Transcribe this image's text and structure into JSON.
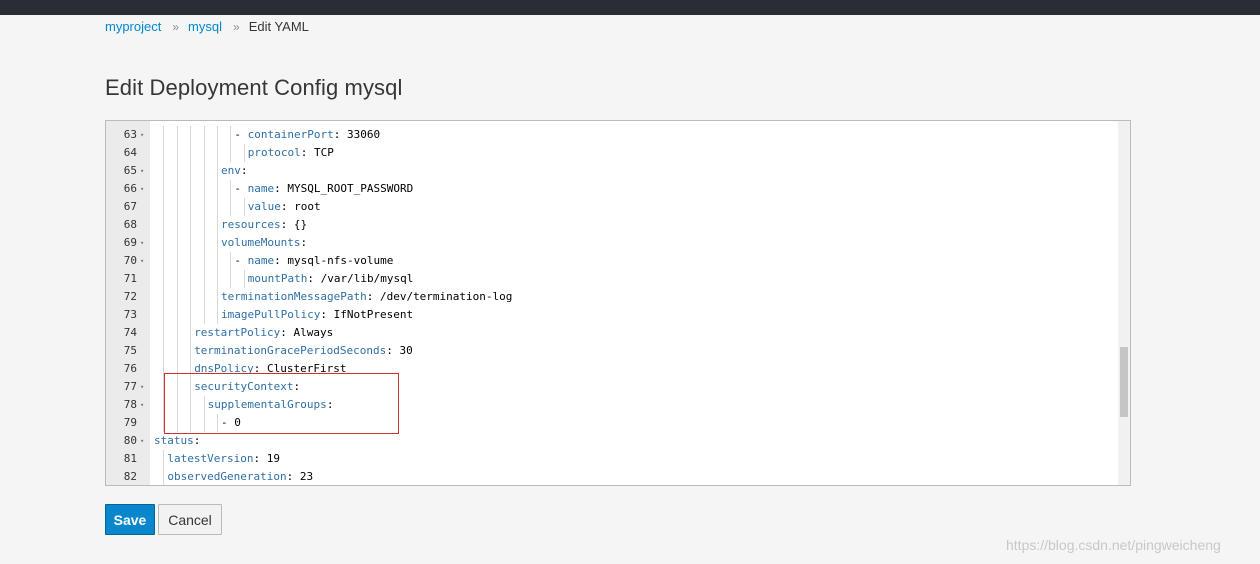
{
  "breadcrumb": {
    "items": [
      {
        "label": "myproject"
      },
      {
        "label": "mysql"
      }
    ],
    "separator": "»",
    "current": "Edit YAML"
  },
  "page_title": "Edit Deployment Config mysql",
  "editor": {
    "lines": [
      {
        "num": "63",
        "fold": true,
        "indent": 6,
        "dash": true,
        "key": "containerPort",
        "value": " 33060"
      },
      {
        "num": "64",
        "fold": false,
        "indent": 7,
        "dash": false,
        "key": "protocol",
        "value": " TCP"
      },
      {
        "num": "65",
        "fold": true,
        "indent": 5,
        "dash": false,
        "key": "env",
        "value": ""
      },
      {
        "num": "66",
        "fold": true,
        "indent": 6,
        "dash": true,
        "key": "name",
        "value": " MYSQL_ROOT_PASSWORD"
      },
      {
        "num": "67",
        "fold": false,
        "indent": 7,
        "dash": false,
        "key": "value",
        "value": " root"
      },
      {
        "num": "68",
        "fold": false,
        "indent": 5,
        "dash": false,
        "key": "resources",
        "value": " {}"
      },
      {
        "num": "69",
        "fold": true,
        "indent": 5,
        "dash": false,
        "key": "volumeMounts",
        "value": ""
      },
      {
        "num": "70",
        "fold": true,
        "indent": 6,
        "dash": true,
        "key": "name",
        "value": " mysql-nfs-volume"
      },
      {
        "num": "71",
        "fold": false,
        "indent": 7,
        "dash": false,
        "key": "mountPath",
        "value": " /var/lib/mysql"
      },
      {
        "num": "72",
        "fold": false,
        "indent": 5,
        "dash": false,
        "key": "terminationMessagePath",
        "value": " /dev/termination-log"
      },
      {
        "num": "73",
        "fold": false,
        "indent": 5,
        "dash": false,
        "key": "imagePullPolicy",
        "value": " IfNotPresent"
      },
      {
        "num": "74",
        "fold": false,
        "indent": 3,
        "dash": false,
        "key": "restartPolicy",
        "value": " Always"
      },
      {
        "num": "75",
        "fold": false,
        "indent": 3,
        "dash": false,
        "key": "terminationGracePeriodSeconds",
        "value": " 30"
      },
      {
        "num": "76",
        "fold": false,
        "indent": 3,
        "dash": false,
        "key": "dnsPolicy",
        "value": " ClusterFirst"
      },
      {
        "num": "77",
        "fold": true,
        "indent": 3,
        "dash": false,
        "key": "securityContext",
        "value": ""
      },
      {
        "num": "78",
        "fold": true,
        "indent": 4,
        "dash": false,
        "key": "supplementalGroups",
        "value": ""
      },
      {
        "num": "79",
        "fold": false,
        "indent": 5,
        "dash": true,
        "key": "",
        "value": "0"
      },
      {
        "num": "80",
        "fold": true,
        "indent": 0,
        "dash": false,
        "key": "status",
        "value": ""
      },
      {
        "num": "81",
        "fold": false,
        "indent": 1,
        "dash": false,
        "key": "latestVersion",
        "value": " 19"
      },
      {
        "num": "82",
        "fold": false,
        "indent": 1,
        "dash": false,
        "key": "observedGeneration",
        "value": " 23"
      }
    ]
  },
  "buttons": {
    "save_label": "Save",
    "cancel_label": "Cancel"
  },
  "watermark": "https://blog.csdn.net/pingweicheng",
  "colors": {
    "link": "#0088ce",
    "primary_button": "#0a86cd",
    "yaml_key": "#2e6fa6",
    "highlight_box": "#d2322d",
    "topbar": "#292e34"
  }
}
